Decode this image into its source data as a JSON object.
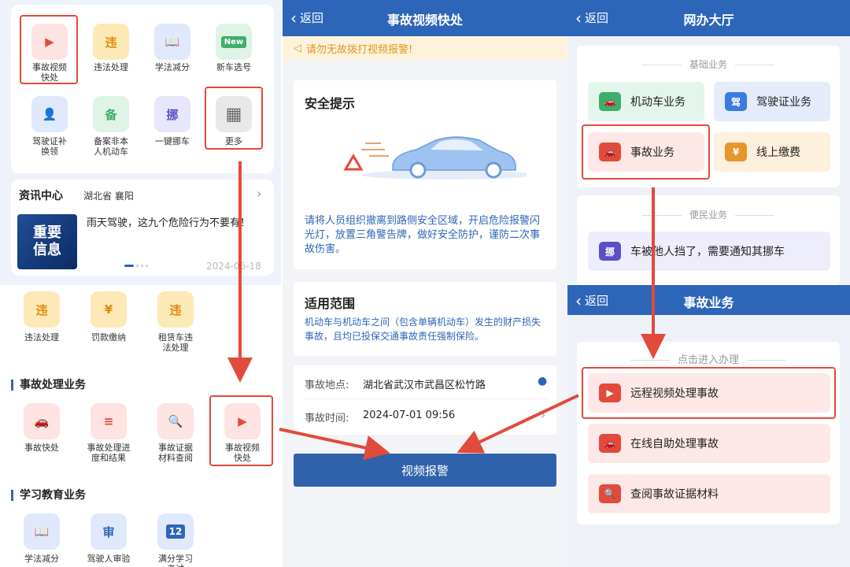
{
  "panel1": {
    "grid_row1": [
      {
        "label": "事故视频\n快处",
        "glyph": "▶"
      },
      {
        "label": "违法处理",
        "glyph": "违"
      },
      {
        "label": "学法减分",
        "glyph": "📖"
      },
      {
        "label": "新车选号",
        "glyph": "New"
      }
    ],
    "grid_row2": [
      {
        "label": "驾驶证补\n换领",
        "glyph": "👤"
      },
      {
        "label": "备案非本\n人机动车",
        "glyph": "备"
      },
      {
        "label": "一键挪车",
        "glyph": "挪"
      },
      {
        "label": "更多",
        "glyph": "▦"
      }
    ],
    "news": {
      "header": "资讯中心",
      "location": "湖北省 襄阳",
      "thumb_text": "重要\n信息",
      "headline": "雨天驾驶，这九个危险行为不要有！",
      "date": "2024-06-18"
    }
  },
  "panel2": {
    "grid_row1": [
      {
        "label": "违法处理",
        "glyph": "违"
      },
      {
        "label": "罚款缴纳",
        "glyph": "¥"
      },
      {
        "label": "租赁车违\n法处理",
        "glyph": "违"
      }
    ],
    "section1_title": "事故处理业务",
    "section1_items": [
      {
        "label": "事故快处",
        "glyph": "🚗"
      },
      {
        "label": "事故处理进\n度和结果",
        "glyph": "≡"
      },
      {
        "label": "事故证据\n材料查阅",
        "glyph": "🔍"
      },
      {
        "label": "事故视频\n快处",
        "glyph": "▶"
      }
    ],
    "section2_title": "学习教育业务",
    "section2_items": [
      {
        "label": "学法减分",
        "glyph": "📖"
      },
      {
        "label": "驾驶人审验",
        "glyph": "审"
      },
      {
        "label": "满分学习\n考试",
        "glyph": "12"
      }
    ]
  },
  "panel3": {
    "back": "返回",
    "title": "事故视频快处",
    "warning": "请勿无故拨打视频报警!",
    "safety_title": "安全提示",
    "safety_text": "请将人员组织撤离到路侧安全区域，开启危险报警闪光灯，放置三角警告牌，做好安全防护，谨防二次事故伤害。",
    "scope_title": "适用范围",
    "scope_text": "机动车与机动车之间（包含单辆机动车）发生的财产损失事故，且均已投保交通事故责任强制保险。",
    "location_label": "事故地点:",
    "location_value": "湖北省武汉市武昌区松竹路",
    "time_label": "事故时间:",
    "time_value": "2024-07-01 09:56",
    "button": "视频报警"
  },
  "panel4": {
    "back": "返回",
    "title": "网办大厅",
    "basic_label": "基础业务",
    "basic_items": [
      {
        "label": "机动车业务",
        "glyph": "🚗"
      },
      {
        "label": "驾驶证业务",
        "glyph": "驾"
      },
      {
        "label": "事故业务",
        "glyph": "🚗"
      },
      {
        "label": "线上缴费",
        "glyph": "¥"
      }
    ],
    "convenience_label": "便民业务",
    "convenience_item": "车被他人挡了，需要通知其挪车"
  },
  "panel5": {
    "back": "返回",
    "title": "事故业务",
    "enter_label": "点击进入办理",
    "items": [
      {
        "label": "远程视频处理事故",
        "glyph": "▶"
      },
      {
        "label": "在线自助处理事故",
        "glyph": "🚗"
      },
      {
        "label": "查阅事故证据材料",
        "glyph": "🔍"
      }
    ]
  },
  "colors": {
    "nav_blue": "#2d66b8",
    "highlight_red": "#e24a3b",
    "warning_text": "#e0962a",
    "button_blue": "#2f62ab"
  }
}
